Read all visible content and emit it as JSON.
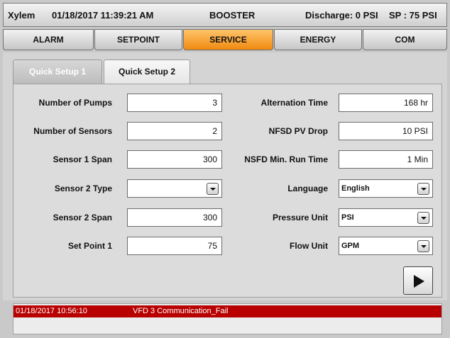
{
  "header": {
    "app": "Xylem",
    "datetime": "01/18/2017 11:39:21 AM",
    "screen": "BOOSTER",
    "discharge": "Discharge: 0 PSI",
    "setpoint": "SP : 75 PSI"
  },
  "nav": {
    "items": [
      {
        "label": "ALARM"
      },
      {
        "label": "SETPOINT"
      },
      {
        "label": "SERVICE"
      },
      {
        "label": "ENERGY"
      },
      {
        "label": "COM"
      }
    ],
    "active": "SERVICE"
  },
  "subtabs": {
    "items": [
      {
        "label": "Quick Setup 1"
      },
      {
        "label": "Quick Setup 2"
      }
    ],
    "active": "Quick Setup 1"
  },
  "fields": {
    "number_of_pumps": {
      "label": "Number of Pumps",
      "value": "3"
    },
    "number_of_sensors": {
      "label": "Number of Sensors",
      "value": "2"
    },
    "sensor1_span": {
      "label": "Sensor 1 Span",
      "value": "300"
    },
    "sensor2_type": {
      "label": "Sensor 2 Type",
      "value": ""
    },
    "sensor2_span": {
      "label": "Sensor 2 Span",
      "value": "300"
    },
    "set_point_1": {
      "label": "Set Point 1",
      "value": "75"
    },
    "alternation_time": {
      "label": "Alternation Time",
      "value": "168 hr"
    },
    "nfsd_pv_drop": {
      "label": "NFSD PV Drop",
      "value": "10 PSI"
    },
    "nsfd_min_run_time": {
      "label": "NSFD Min. Run Time",
      "value": "1 Min"
    },
    "language": {
      "label": "Language",
      "value": "English"
    },
    "pressure_unit": {
      "label": "Pressure Unit",
      "value": "PSI"
    },
    "flow_unit": {
      "label": "Flow Unit",
      "value": "GPM"
    }
  },
  "alarm": {
    "timestamp": "01/18/2017 10:56:10",
    "message": "VFD 3 Communication_Fail",
    "color": "#b80000"
  },
  "colors": {
    "active_tab": "#f08a10",
    "alarm_bar": "#b80000"
  },
  "icons": {
    "next": "play-arrow-icon",
    "dropdown": "chevron-down-icon"
  }
}
